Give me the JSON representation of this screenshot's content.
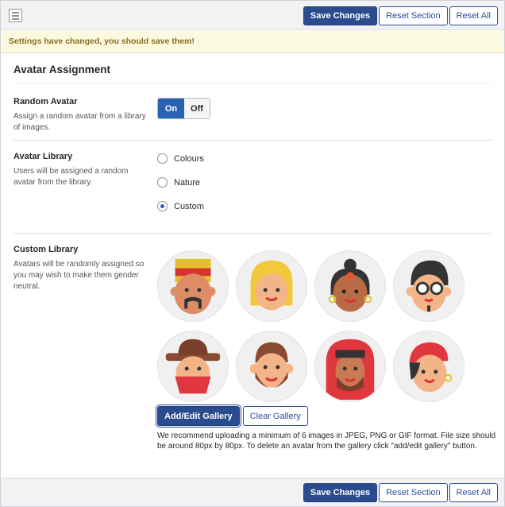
{
  "toolbar": {
    "save_label": "Save Changes",
    "reset_section_label": "Reset Section",
    "reset_all_label": "Reset All"
  },
  "notice": {
    "text": "Settings have changed, you should save them!"
  },
  "section": {
    "title": "Avatar Assignment"
  },
  "random_avatar": {
    "label": "Random Avatar",
    "description": "Assign a random avatar from a library of images.",
    "on_label": "On",
    "off_label": "Off",
    "value": "On"
  },
  "avatar_library": {
    "label": "Avatar Library",
    "description": "Users will be assigned a random avatar from the library.",
    "options": [
      {
        "label": "Colours",
        "checked": false
      },
      {
        "label": "Nature",
        "checked": false
      },
      {
        "label": "Custom",
        "checked": true
      }
    ]
  },
  "custom_library": {
    "label": "Custom Library",
    "description": "Avatars will be randomly assigned so you may wish to make them gender neutral.",
    "avatars": [
      "avatar-icon",
      "avatar-icon",
      "avatar-icon",
      "avatar-icon",
      "avatar-icon",
      "avatar-icon",
      "avatar-icon",
      "avatar-icon"
    ],
    "add_edit_label": "Add/Edit Gallery",
    "clear_label": "Clear Gallery",
    "note": "We recommend uploading a minimum of 6 images in JPEG, PNG or GIF format. File size should be around 80px by 80px. To delete an avatar from the gallery click \"add/edit gallery\" button."
  },
  "colors": {
    "primary": "#2a4b8d",
    "toggle_on": "#2a62b3",
    "notice_bg": "#fcf9e1",
    "notice_text": "#8a6d1e"
  }
}
